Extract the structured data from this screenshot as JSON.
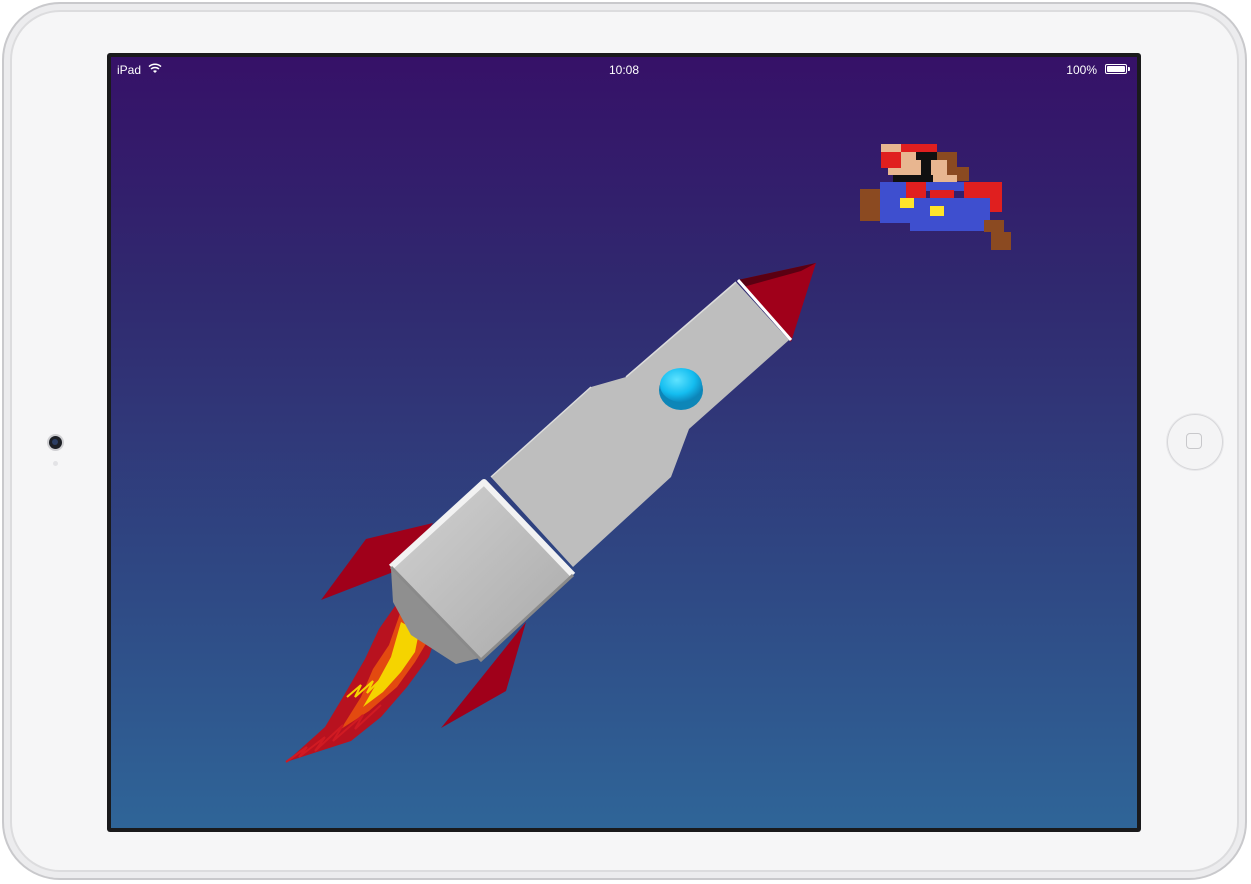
{
  "status_bar": {
    "carrier": "iPad",
    "time": "10:08",
    "battery_percent": "100%",
    "wifi_icon": "wifi-icon",
    "battery_icon": "battery-icon",
    "battery_level": 1.0
  },
  "device": {
    "name": "iPad",
    "orientation": "landscape"
  },
  "scene": {
    "background_top_color": "#361168",
    "background_bottom_color": "#2f6598",
    "objects": [
      "rocket",
      "rocket-flame",
      "mario-sprite"
    ]
  },
  "colors": {
    "rocket_body": "#bdbdbd",
    "rocket_fins": "#a0001a",
    "porthole": "#16c6f2",
    "flame_red": "#c0152a",
    "flame_yellow": "#f5d400"
  }
}
